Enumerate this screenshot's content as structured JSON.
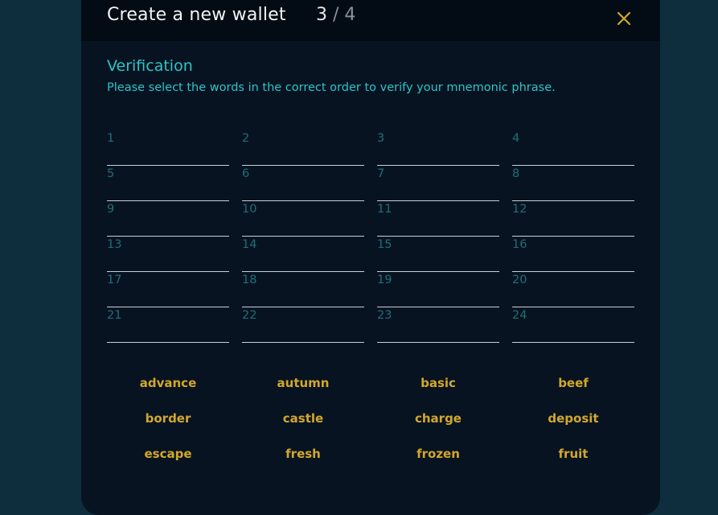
{
  "header": {
    "title": "Create a new wallet",
    "step_current": "3",
    "step_separator": "/",
    "step_total": "4",
    "close_icon": "close-icon"
  },
  "section": {
    "title": "Verification",
    "subtitle": "Please select the words in the correct order to verify your mnemonic phrase."
  },
  "slots": [
    "1",
    "2",
    "3",
    "4",
    "5",
    "6",
    "7",
    "8",
    "9",
    "10",
    "11",
    "12",
    "13",
    "14",
    "15",
    "16",
    "17",
    "18",
    "19",
    "20",
    "21",
    "22",
    "23",
    "24"
  ],
  "words": [
    "advance",
    "autumn",
    "basic",
    "beef",
    "border",
    "castle",
    "charge",
    "deposit",
    "escape",
    "fresh",
    "frozen",
    "fruit"
  ],
  "colors": {
    "background": "#0e2e3e",
    "modal": "#081321",
    "header": "#030b14",
    "accent_teal": "#2ac6c8",
    "word_gold": "#d2a72b",
    "slot_number": "#1f6e78"
  }
}
